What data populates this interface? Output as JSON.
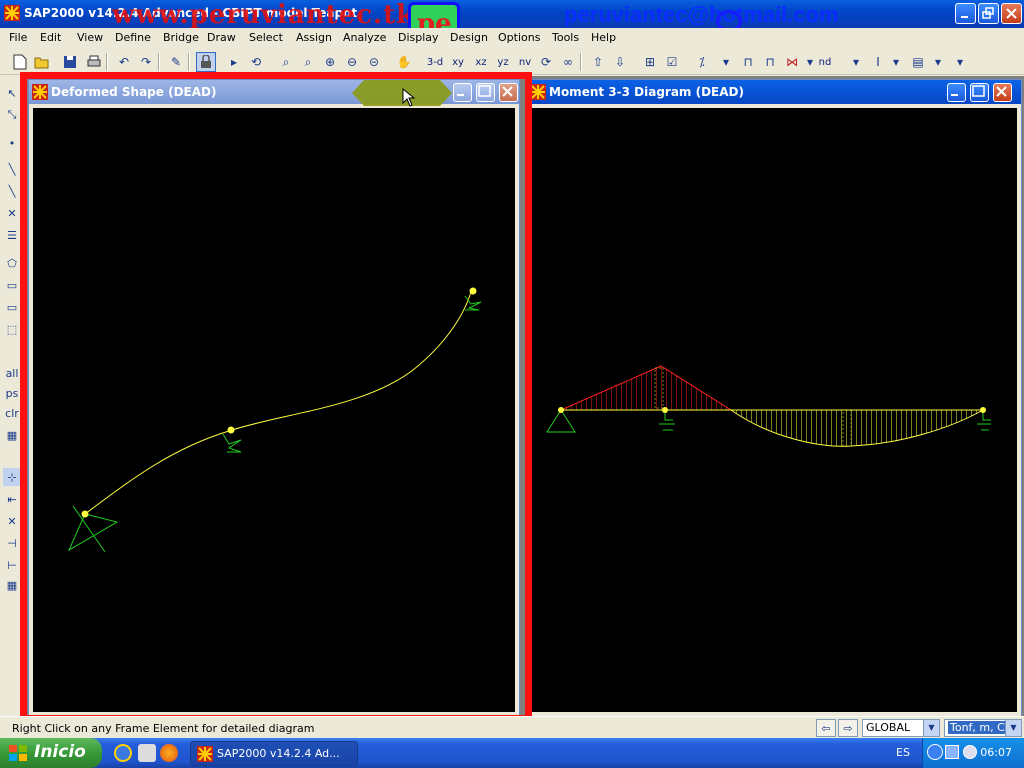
{
  "app": {
    "title": "SAP2000 v14.2.4 Advanced  - CBIPT model Teapot",
    "watermark_text": "www.peruviantec.tk",
    "watermark_email": "peruviantec@hotmail.com",
    "watermark_logo": "pe"
  },
  "menu": [
    "File",
    "Edit",
    "View",
    "Define",
    "Bridge",
    "Draw",
    "Select",
    "Assign",
    "Analyze",
    "Display",
    "Design",
    "Options",
    "Tools",
    "Help"
  ],
  "toolbar": {
    "view_buttons": [
      "3-d",
      "xy",
      "xz",
      "yz",
      "nv"
    ],
    "nd_label": "nd"
  },
  "left_toolbar": {
    "labels": [
      "all",
      "ps",
      "clr"
    ]
  },
  "windows": {
    "left": {
      "title": "Deformed Shape (DEAD)",
      "state": "inactive"
    },
    "right": {
      "title": "Moment 3-3 Diagram   (DEAD)",
      "state": "active"
    }
  },
  "status": {
    "message": "Right Click on any Frame Element for detailed diagram",
    "coord_system": "GLOBAL",
    "units": "Tonf, m, C"
  },
  "taskbar": {
    "start_label": "Inicio",
    "task_label": "SAP2000 v14.2.4 Ad...",
    "language": "ES",
    "clock": "06:07"
  },
  "colors": {
    "deformed_line": "#ffff40",
    "support": "#22cc22",
    "moment_negative": "#ff2020",
    "moment_positive": "#ffff40",
    "highlight_frame": "#ff1010"
  }
}
